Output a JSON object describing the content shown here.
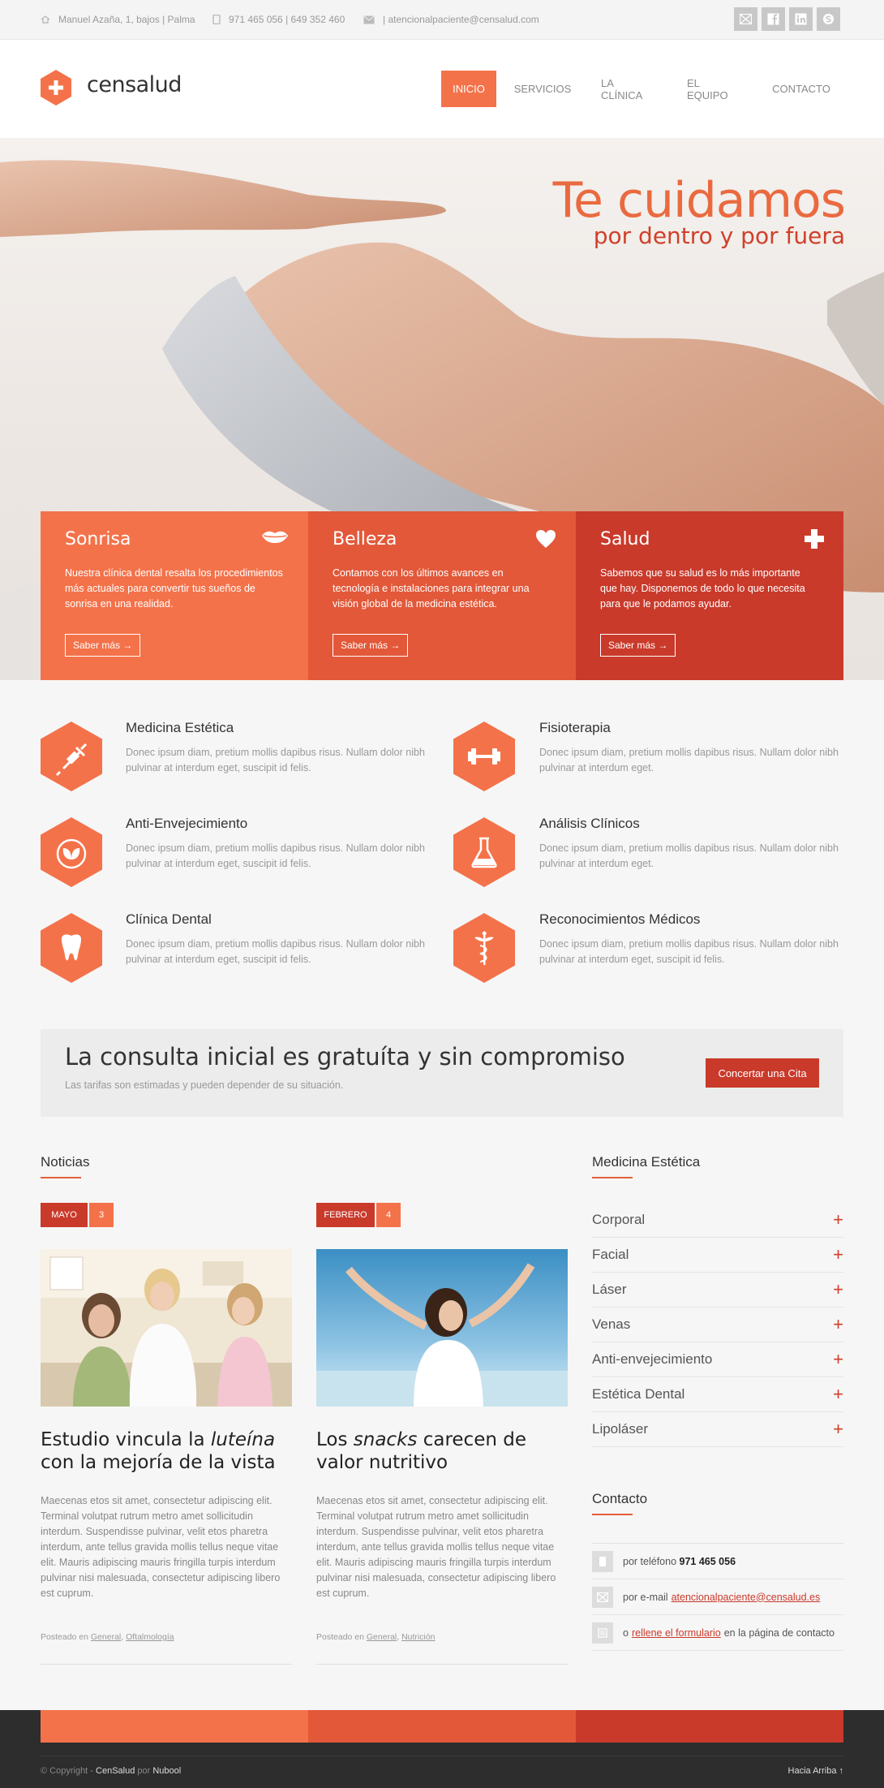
{
  "topbar": {
    "address": "Manuel Azaña, 1, bajos | Palma",
    "phone": "971 465 056 | 649 352 460",
    "email": "| atencionalpaciente@censalud.com"
  },
  "brand": {
    "name": "censalud",
    "accent": "#f4724a",
    "dark_red": "#c93a2b"
  },
  "nav": {
    "items": [
      "INICIO",
      "SERVICIOS",
      "LA CLÍNICA",
      "EL EQUIPO",
      "CONTACTO"
    ]
  },
  "hero": {
    "title": "Te cuidamos",
    "subtitle": "por dentro y por fuera"
  },
  "boxes": [
    {
      "title": "Sonrisa",
      "text": "Nuestra clínica dental resalta los procedimientos más actuales para convertir tus sueños de sonrisa en una realidad.",
      "button": "Saber más →",
      "color": "#f4724a"
    },
    {
      "title": "Belleza",
      "text": "Contamos con los últimos avances en tecnología e instalaciones para integrar una visión global de la medicina estética.",
      "button": "Saber más →",
      "color": "#e25839"
    },
    {
      "title": "Salud",
      "text": "Sabemos que su salud es lo más importante que hay. Disponemos de todo lo que necesita para que le podamos ayudar.",
      "button": "Saber más →",
      "color": "#c93a2b"
    }
  ],
  "services": [
    {
      "title": "Medicina Estética",
      "text": "Donec ipsum diam, pretium mollis dapibus risus. Nullam dolor nibh pulvinar at interdum eget, suscipit id felis.",
      "icon": "syringe-icon"
    },
    {
      "title": "Fisioterapia",
      "text": "Donec ipsum diam, pretium mollis dapibus risus. Nullam dolor nibh pulvinar at interdum eget.",
      "icon": "dumbbell-icon"
    },
    {
      "title": "Anti-Envejecimiento",
      "text": "Donec ipsum diam, pretium mollis dapibus risus. Nullam dolor nibh pulvinar at interdum eget, suscipit id felis.",
      "icon": "leaf-icon"
    },
    {
      "title": "Análisis Clínicos",
      "text": "Donec ipsum diam, pretium mollis dapibus risus. Nullam dolor nibh pulvinar at interdum eget.",
      "icon": "flask-icon"
    },
    {
      "title": "Clínica Dental",
      "text": "Donec ipsum diam, pretium mollis dapibus risus. Nullam dolor nibh pulvinar at interdum eget, suscipit id felis.",
      "icon": "tooth-icon"
    },
    {
      "title": "Reconocimientos Médicos",
      "text": "Donec ipsum diam, pretium mollis dapibus risus. Nullam dolor nibh pulvinar at interdum eget, suscipit id felis.",
      "icon": "caduceus-icon"
    }
  ],
  "cta": {
    "title": "La consulta inicial es gratuíta y sin compromiso",
    "text": "Las tarifas son estimadas y pueden depender de su situación.",
    "button": "Concertar una Cita"
  },
  "news": {
    "section_title": "Noticias",
    "posts": [
      {
        "month": "MAYO",
        "day": "3",
        "title_a": "Estudio vincula la ",
        "title_em": "luteína",
        "title_b": " con la mejoría de la vista",
        "text": "Maecenas etos sit amet, consectetur adipiscing elit. Terminal volutpat rutrum metro amet sollicitudin interdum. Suspendisse pulvinar, velit etos pharetra interdum, ante tellus gravida mollis tellus neque vitae elit. Mauris adipiscing mauris fringilla turpis interdum pulvinar nisi malesuada, consectetur adipiscing libero est cuprum.",
        "posted": "Posteado en",
        "cat1": "General",
        "cat2": "Oftalmología"
      },
      {
        "month": "FEBRERO",
        "day": "4",
        "title_a": "Los ",
        "title_em": "snacks",
        "title_b": " carecen de valor nutritivo",
        "text": "Maecenas etos sit amet, consectetur adipiscing elit. Terminal volutpat rutrum metro amet sollicitudin interdum. Suspendisse pulvinar, velit etos pharetra interdum, ante tellus gravida mollis tellus neque vitae elit. Mauris adipiscing mauris fringilla turpis interdum pulvinar nisi malesuada, consectetur adipiscing libero est cuprum.",
        "posted": "Posteado en",
        "cat1": "General",
        "cat2": "Nutrición"
      }
    ]
  },
  "sidebar": {
    "med_title": "Medicina Estética",
    "items": [
      "Corporal",
      "Facial",
      "Láser",
      "Venas",
      "Anti-envejecimiento",
      "Estética Dental",
      "Lipoláser"
    ],
    "contact_title": "Contacto",
    "phone_label": "por teléfono",
    "phone": "971 465 056",
    "email_label": "por e-mail",
    "email": "atencionalpaciente@censalud.es",
    "form_pre": "o",
    "form_link": "rellene el formulario",
    "form_post": "en la página de contacto"
  },
  "footer": {
    "copy": "© Copyright - ",
    "brand": "CenSalud",
    "por": " por ",
    "author": "Nubool",
    "top": "Hacia Arriba  ↑"
  }
}
